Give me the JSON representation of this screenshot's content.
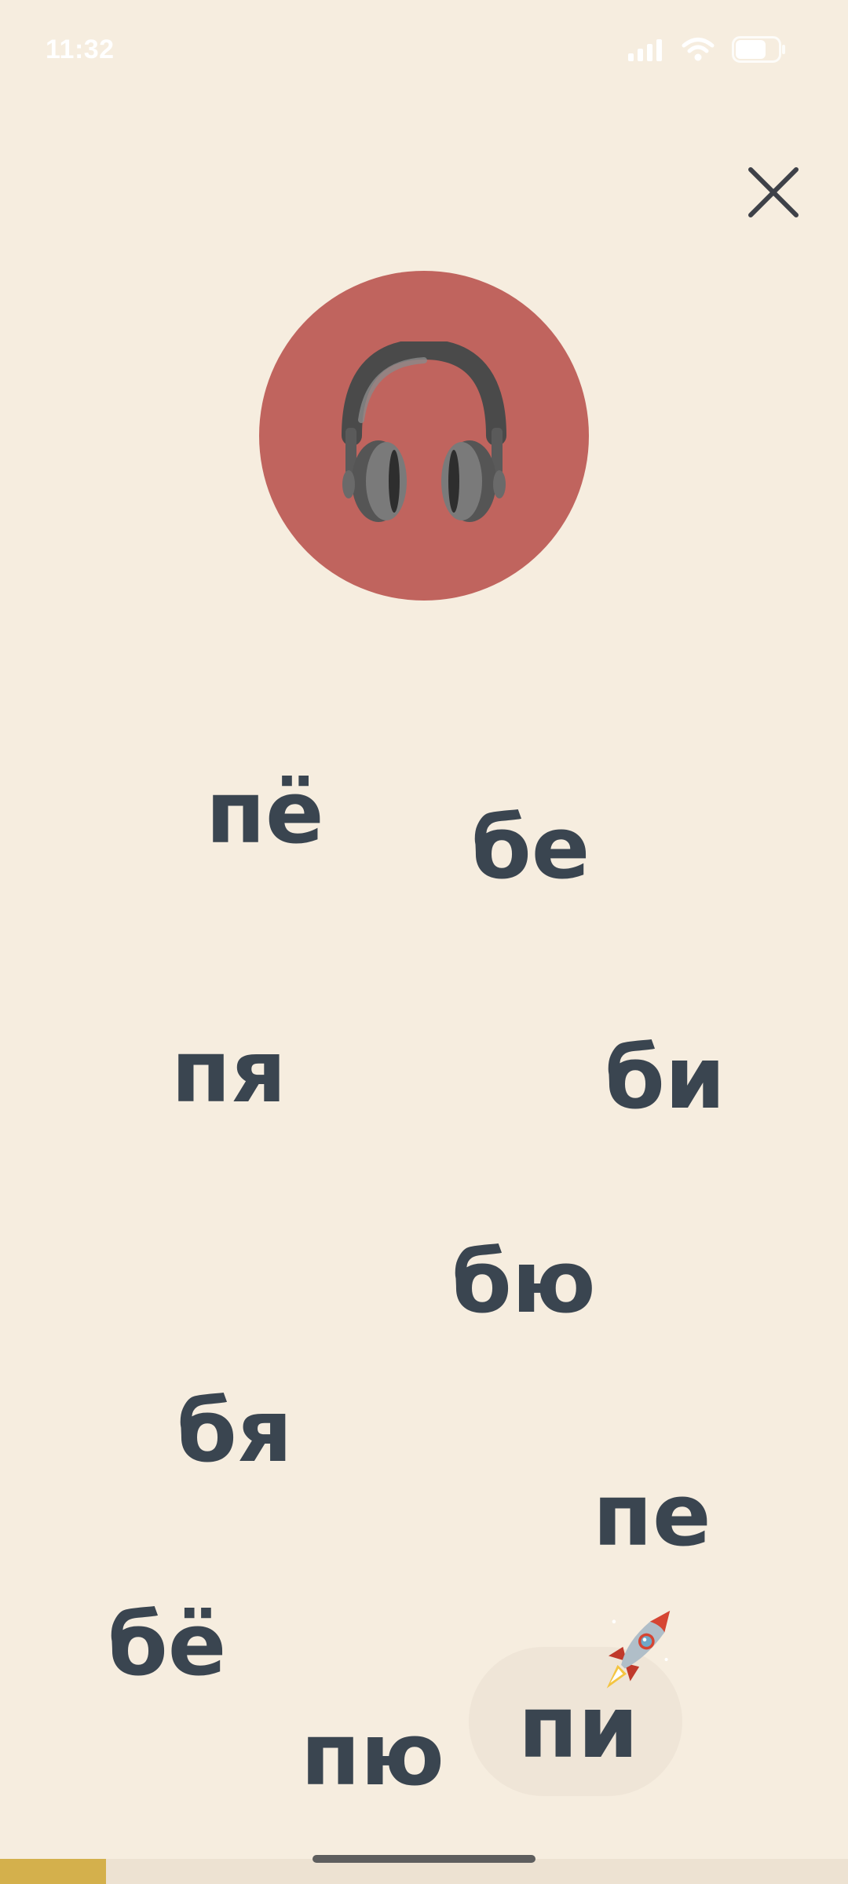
{
  "status_bar": {
    "time": "11:32",
    "icons": [
      "cellular-signal-icon",
      "wifi-icon",
      "battery-icon"
    ]
  },
  "header": {
    "close_icon": "close-icon"
  },
  "listen_button": {
    "icon": "headphones-icon",
    "color": "#C0645E"
  },
  "syllables": {
    "pyo": "пё",
    "be": "бе",
    "pya": "пя",
    "bi": "би",
    "byu": "бю",
    "bya": "бя",
    "pe": "пе",
    "byo": "бё",
    "pyu": "пю",
    "pi": "пи"
  },
  "selected_syllable": "пи",
  "rocket_icon": "rocket-icon",
  "progress": {
    "fraction": 0.125,
    "color": "#D4B04C"
  },
  "colors": {
    "background": "#F6EDDF",
    "text": "#3A4550"
  }
}
